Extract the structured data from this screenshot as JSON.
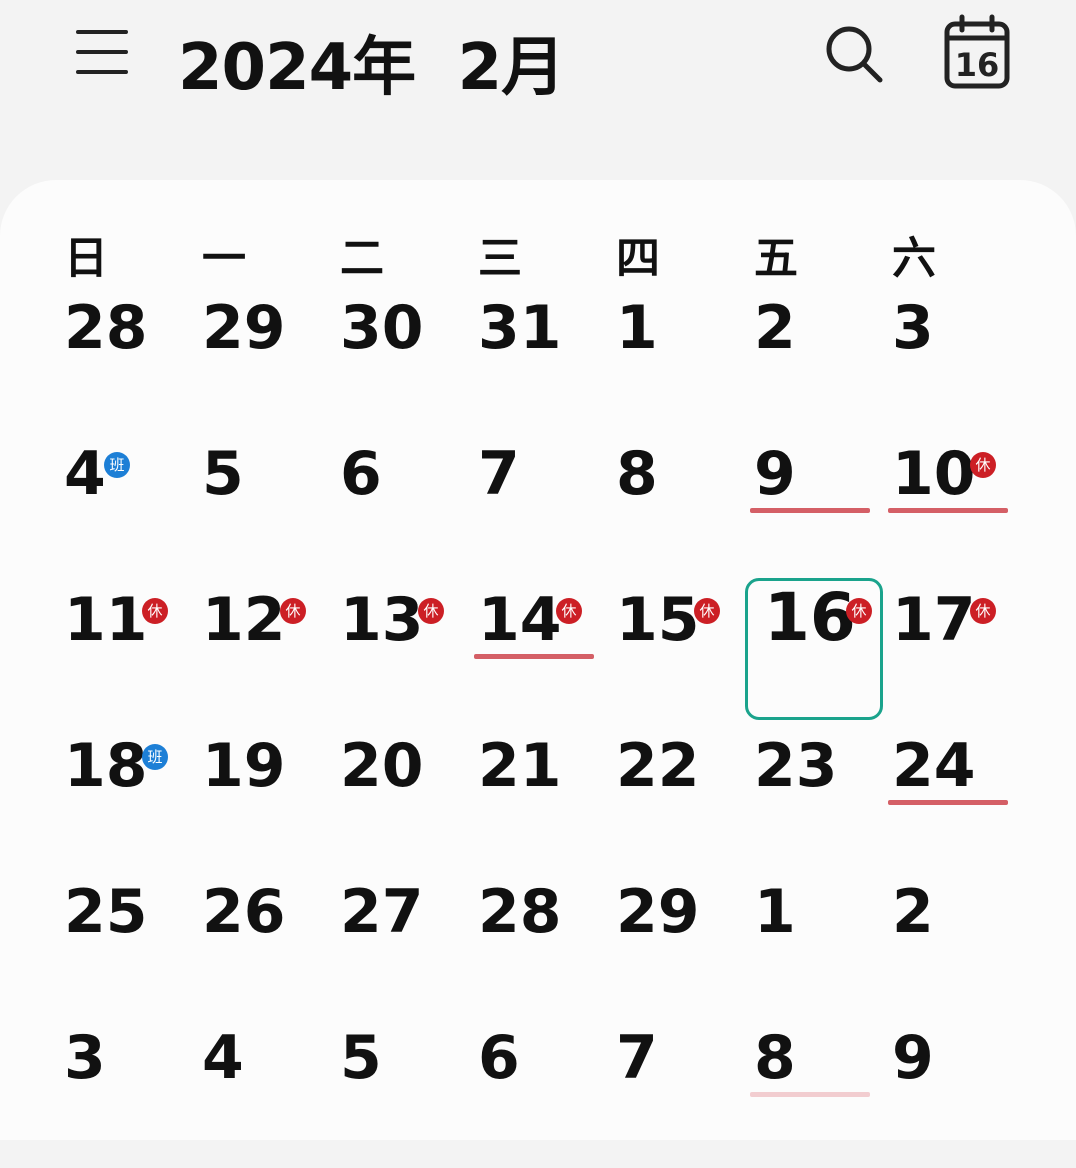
{
  "header": {
    "title": "2024年  2月",
    "today_icon_number": "16"
  },
  "weekdays": [
    "日",
    "一",
    "二",
    "三",
    "四",
    "五",
    "六"
  ],
  "colors": {
    "rest_badge": "#cc1f25",
    "work_badge": "#1d7fd6",
    "underline": "#d45f66",
    "today_border": "#1aa38c"
  },
  "badges": {
    "rest": "休",
    "work": "班"
  },
  "weeks": [
    [
      {
        "num": "28"
      },
      {
        "num": "29"
      },
      {
        "num": "30"
      },
      {
        "num": "31"
      },
      {
        "num": "1"
      },
      {
        "num": "2"
      },
      {
        "num": "3"
      }
    ],
    [
      {
        "num": "4",
        "badge": "work"
      },
      {
        "num": "5"
      },
      {
        "num": "6"
      },
      {
        "num": "7"
      },
      {
        "num": "8"
      },
      {
        "num": "9",
        "underline": true
      },
      {
        "num": "10",
        "badge": "rest",
        "underline": true
      }
    ],
    [
      {
        "num": "11",
        "badge": "rest"
      },
      {
        "num": "12",
        "badge": "rest"
      },
      {
        "num": "13",
        "badge": "rest"
      },
      {
        "num": "14",
        "badge": "rest",
        "underline": true
      },
      {
        "num": "15",
        "badge": "rest"
      },
      {
        "num": "16",
        "badge": "rest",
        "today": true
      },
      {
        "num": "17",
        "badge": "rest"
      }
    ],
    [
      {
        "num": "18",
        "badge": "work"
      },
      {
        "num": "19"
      },
      {
        "num": "20"
      },
      {
        "num": "21"
      },
      {
        "num": "22"
      },
      {
        "num": "23"
      },
      {
        "num": "24",
        "underline": true
      }
    ],
    [
      {
        "num": "25"
      },
      {
        "num": "26"
      },
      {
        "num": "27"
      },
      {
        "num": "28"
      },
      {
        "num": "29"
      },
      {
        "num": "1"
      },
      {
        "num": "2"
      }
    ],
    [
      {
        "num": "3"
      },
      {
        "num": "4"
      },
      {
        "num": "5"
      },
      {
        "num": "6"
      },
      {
        "num": "7"
      },
      {
        "num": "8",
        "underline": "faint"
      },
      {
        "num": "9"
      }
    ]
  ]
}
